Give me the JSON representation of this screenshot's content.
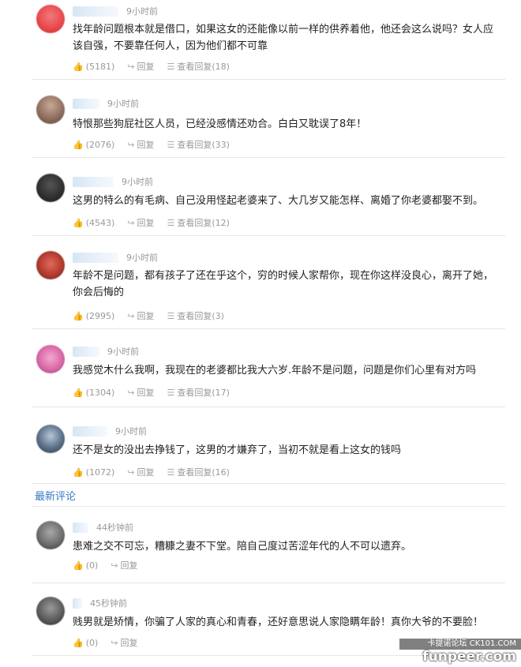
{
  "hot_comments": [
    {
      "time": "9小时前",
      "text": "找年龄问题根本就是借口，如果这女的还能像以前一样的供养着他，他还会这么说吗？女人应该自强，不要靠任何人，因为他们都不可靠",
      "likes": "(5181)",
      "reply": "回复",
      "view_replies": "查看回复(18)",
      "avatar_color": "#e8464a"
    },
    {
      "time": "9小时前",
      "text": "特恨那些狗屁社区人员，已经没感情还劝合。白白又耽误了8年！",
      "likes": "(2076)",
      "reply": "回复",
      "view_replies": "查看回复(33)",
      "avatar_color": "#8a6a5a"
    },
    {
      "time": "9小时前",
      "text": "这男的特么的有毛病、自己没用怪起老婆来了、大几岁又能怎样、离婚了你老婆都娶不到。",
      "likes": "(4543)",
      "reply": "回复",
      "view_replies": "查看回复(12)",
      "avatar_color": "#2d2d2d"
    },
    {
      "time": "9小时前",
      "text": "年龄不是问题，都有孩子了还在乎这个，穷的时候人家帮你，现在你这样没良心，离开了她，你会后悔的",
      "likes": "(2995)",
      "reply": "回复",
      "view_replies": "查看回复(3)",
      "avatar_color": "#b23a2e"
    },
    {
      "time": "9小时前",
      "text": "我感觉木什么我啊，我现在的老婆都比我大六岁.年龄不是问题，问题是你们心里有对方吗",
      "likes": "(1304)",
      "reply": "回复",
      "view_replies": "查看回复(17)",
      "avatar_color": "#d96aa8"
    },
    {
      "time": "9小时前",
      "text": "还不是女的没出去挣钱了，这男的才嫌弃了，当初不就是看上这女的钱吗",
      "likes": "(1072)",
      "reply": "回复",
      "view_replies": "查看回复(16)",
      "avatar_color": "#5a6f88"
    }
  ],
  "section_title": "最新评论",
  "new_comments": [
    {
      "time": "44秒钟前",
      "text": "患难之交不可忘，糟糠之妻不下堂。陪自己度过苦涩年代的人不可以遗弃。",
      "likes": "(0)",
      "reply": "回复",
      "avatar_color": "#6e6e6e"
    },
    {
      "time": "45秒钟前",
      "text": "贱男就是矫情，你骗了人家的真心和青春，还好意思说人家隐瞒年龄！真你大爷的不要脸！",
      "likes": "(0)",
      "reply": "回复",
      "avatar_color": "#5c5c5c"
    }
  ],
  "watermark_small": "卡提诺论坛 CK101.COM",
  "watermark": "funpeer.com"
}
